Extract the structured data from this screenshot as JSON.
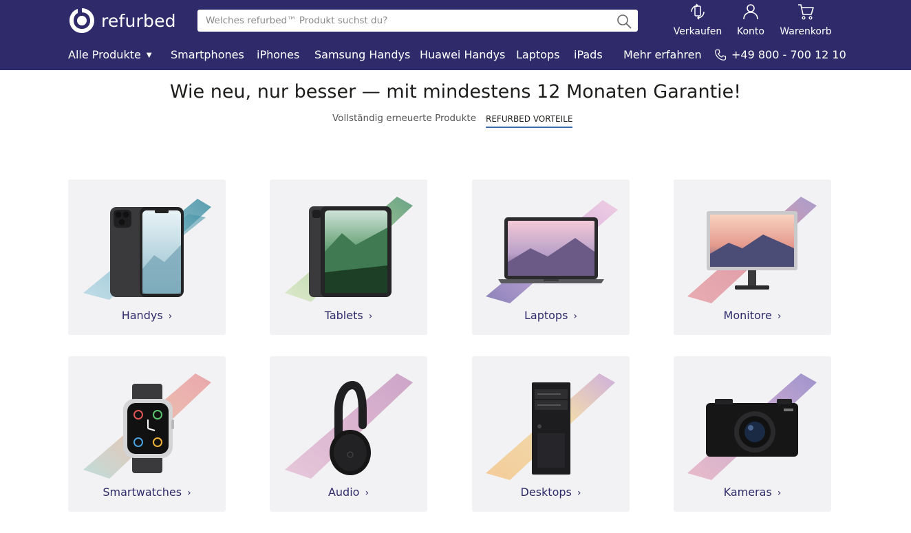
{
  "brand": {
    "name": "refurbed",
    "color_primary": "#2f2b6b"
  },
  "search": {
    "placeholder": "Welches refurbed™ Produkt suchst du?"
  },
  "utility": [
    {
      "label": "Verkaufen",
      "icon": "sell-icon"
    },
    {
      "label": "Konto",
      "icon": "user-icon"
    },
    {
      "label": "Warenkorb",
      "icon": "cart-icon"
    }
  ],
  "nav": {
    "all_products": "Alle Produkte",
    "items": [
      "Smartphones",
      "iPhones",
      "Samsung Handys",
      "Huawei Handys",
      "Laptops",
      "iPads",
      "Mehr erfahren"
    ],
    "phone": "+49 800 - 700 12 10"
  },
  "hero": {
    "title": "Wie neu, nur besser — mit mindestens 12 Monaten Garantie!",
    "tabs": [
      "Vollständig erneuerte Produkte",
      "REFURBED VORTEILE"
    ],
    "active_tab": "REFURBED VORTEILE"
  },
  "categories": [
    {
      "label": "Handys",
      "icon": "smartphone-icon"
    },
    {
      "label": "Tablets",
      "icon": "tablet-icon"
    },
    {
      "label": "Laptops",
      "icon": "laptop-icon"
    },
    {
      "label": "Monitore",
      "icon": "monitor-icon"
    },
    {
      "label": "Smartwatches",
      "icon": "smartwatch-icon"
    },
    {
      "label": "Audio",
      "icon": "headphones-icon"
    },
    {
      "label": "Desktops",
      "icon": "desktop-tower-icon"
    },
    {
      "label": "Kameras",
      "icon": "camera-icon"
    }
  ]
}
